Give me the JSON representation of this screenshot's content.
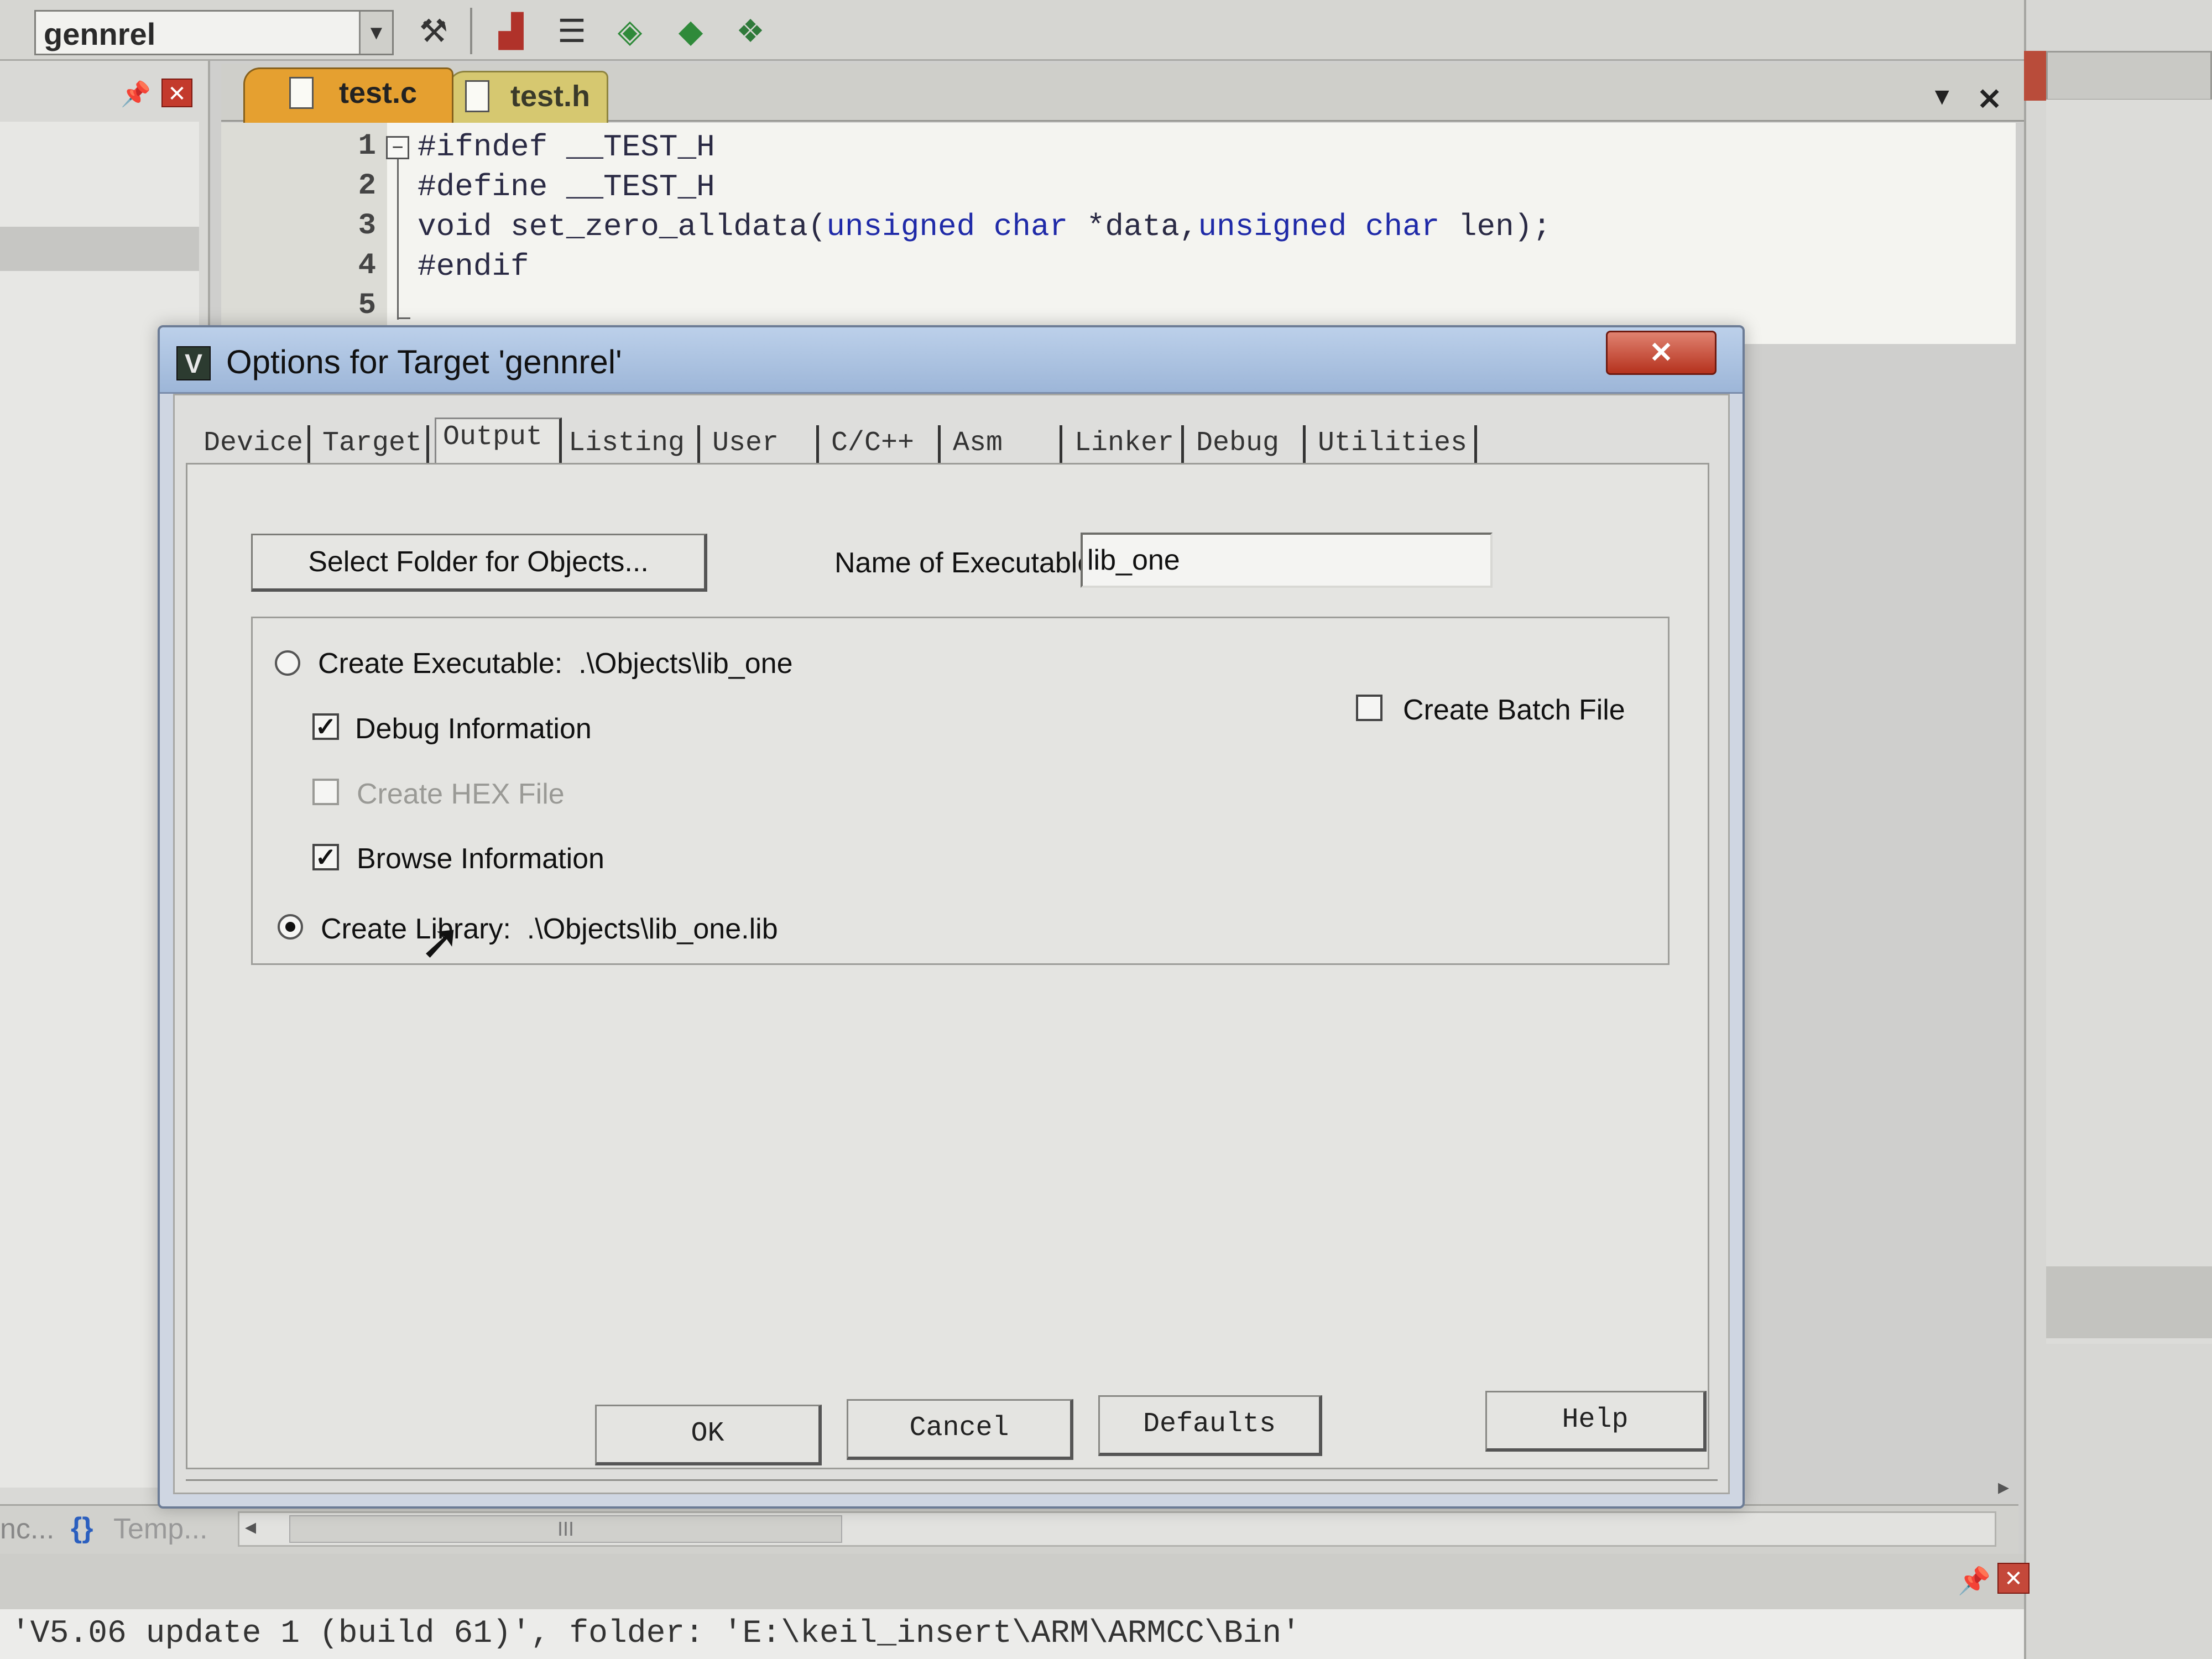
{
  "toolbar": {
    "target_combo_value": "gennrel",
    "icons": [
      "target-options-icon",
      "manage-components-icon",
      "project-items-icon",
      "select-packs-icon",
      "pack-installer-icon",
      "run-time-environment-icon"
    ]
  },
  "editor": {
    "tabs": [
      {
        "label": "test.c",
        "active": true
      },
      {
        "label": "test.h",
        "active": false
      }
    ],
    "line_numbers": [
      "1",
      "2",
      "3",
      "4",
      "5"
    ],
    "lines": [
      {
        "pre": "#ifndef __TEST_H"
      },
      {
        "pre": "#define __TEST_H"
      },
      {
        "p1": "void set_zero_alldata(",
        "k1": "unsigned char",
        "p2": " *data,",
        "k2": "unsigned char",
        "p3": " len);"
      },
      {
        "pre": "#endif"
      },
      {
        "pre": ""
      }
    ]
  },
  "dialog": {
    "title": "Options for Target 'gennrel'",
    "close_label": "✕",
    "tabs": [
      "Device",
      "Target",
      "Output",
      "Listing",
      "User",
      "C/C++",
      "Asm",
      "Linker",
      "Debug",
      "Utilities"
    ],
    "active_tab": "Output",
    "select_folder_label": "Select Folder for Objects...",
    "exe_name_label": "Name of Executable:",
    "exe_name_value": "lib_one",
    "create_executable_label": "Create Executable:  .\\Objects\\lib_one",
    "debug_info_label": "Debug Information",
    "create_hex_label": "Create HEX File",
    "browse_info_label": "Browse Information",
    "create_library_label": "Create Library:  .\\Objects\\lib_one.lib",
    "create_batch_label": "Create Batch File",
    "options": {
      "create_executable": false,
      "create_library": true,
      "debug_information": true,
      "create_hex_file": false,
      "browse_information": true,
      "create_batch_file": false
    },
    "buttons": {
      "ok": "OK",
      "cancel": "Cancel",
      "defaults": "Defaults",
      "help": "Help"
    }
  },
  "bottom": {
    "tab_functions": "nc...",
    "tab_templates": "Temp...",
    "tab_templates_icon": "{}",
    "scroll_grip": "III",
    "build_output": "'V5.06 update 1 (build 61)', folder: 'E:\\keil_insert\\ARM\\ARMCC\\Bin'"
  },
  "colors": {
    "active_tab": "#e5a030",
    "dialog_titlebar": "#9db6d8",
    "close_button": "#b5321e",
    "keyword": "#1f2aa8"
  }
}
